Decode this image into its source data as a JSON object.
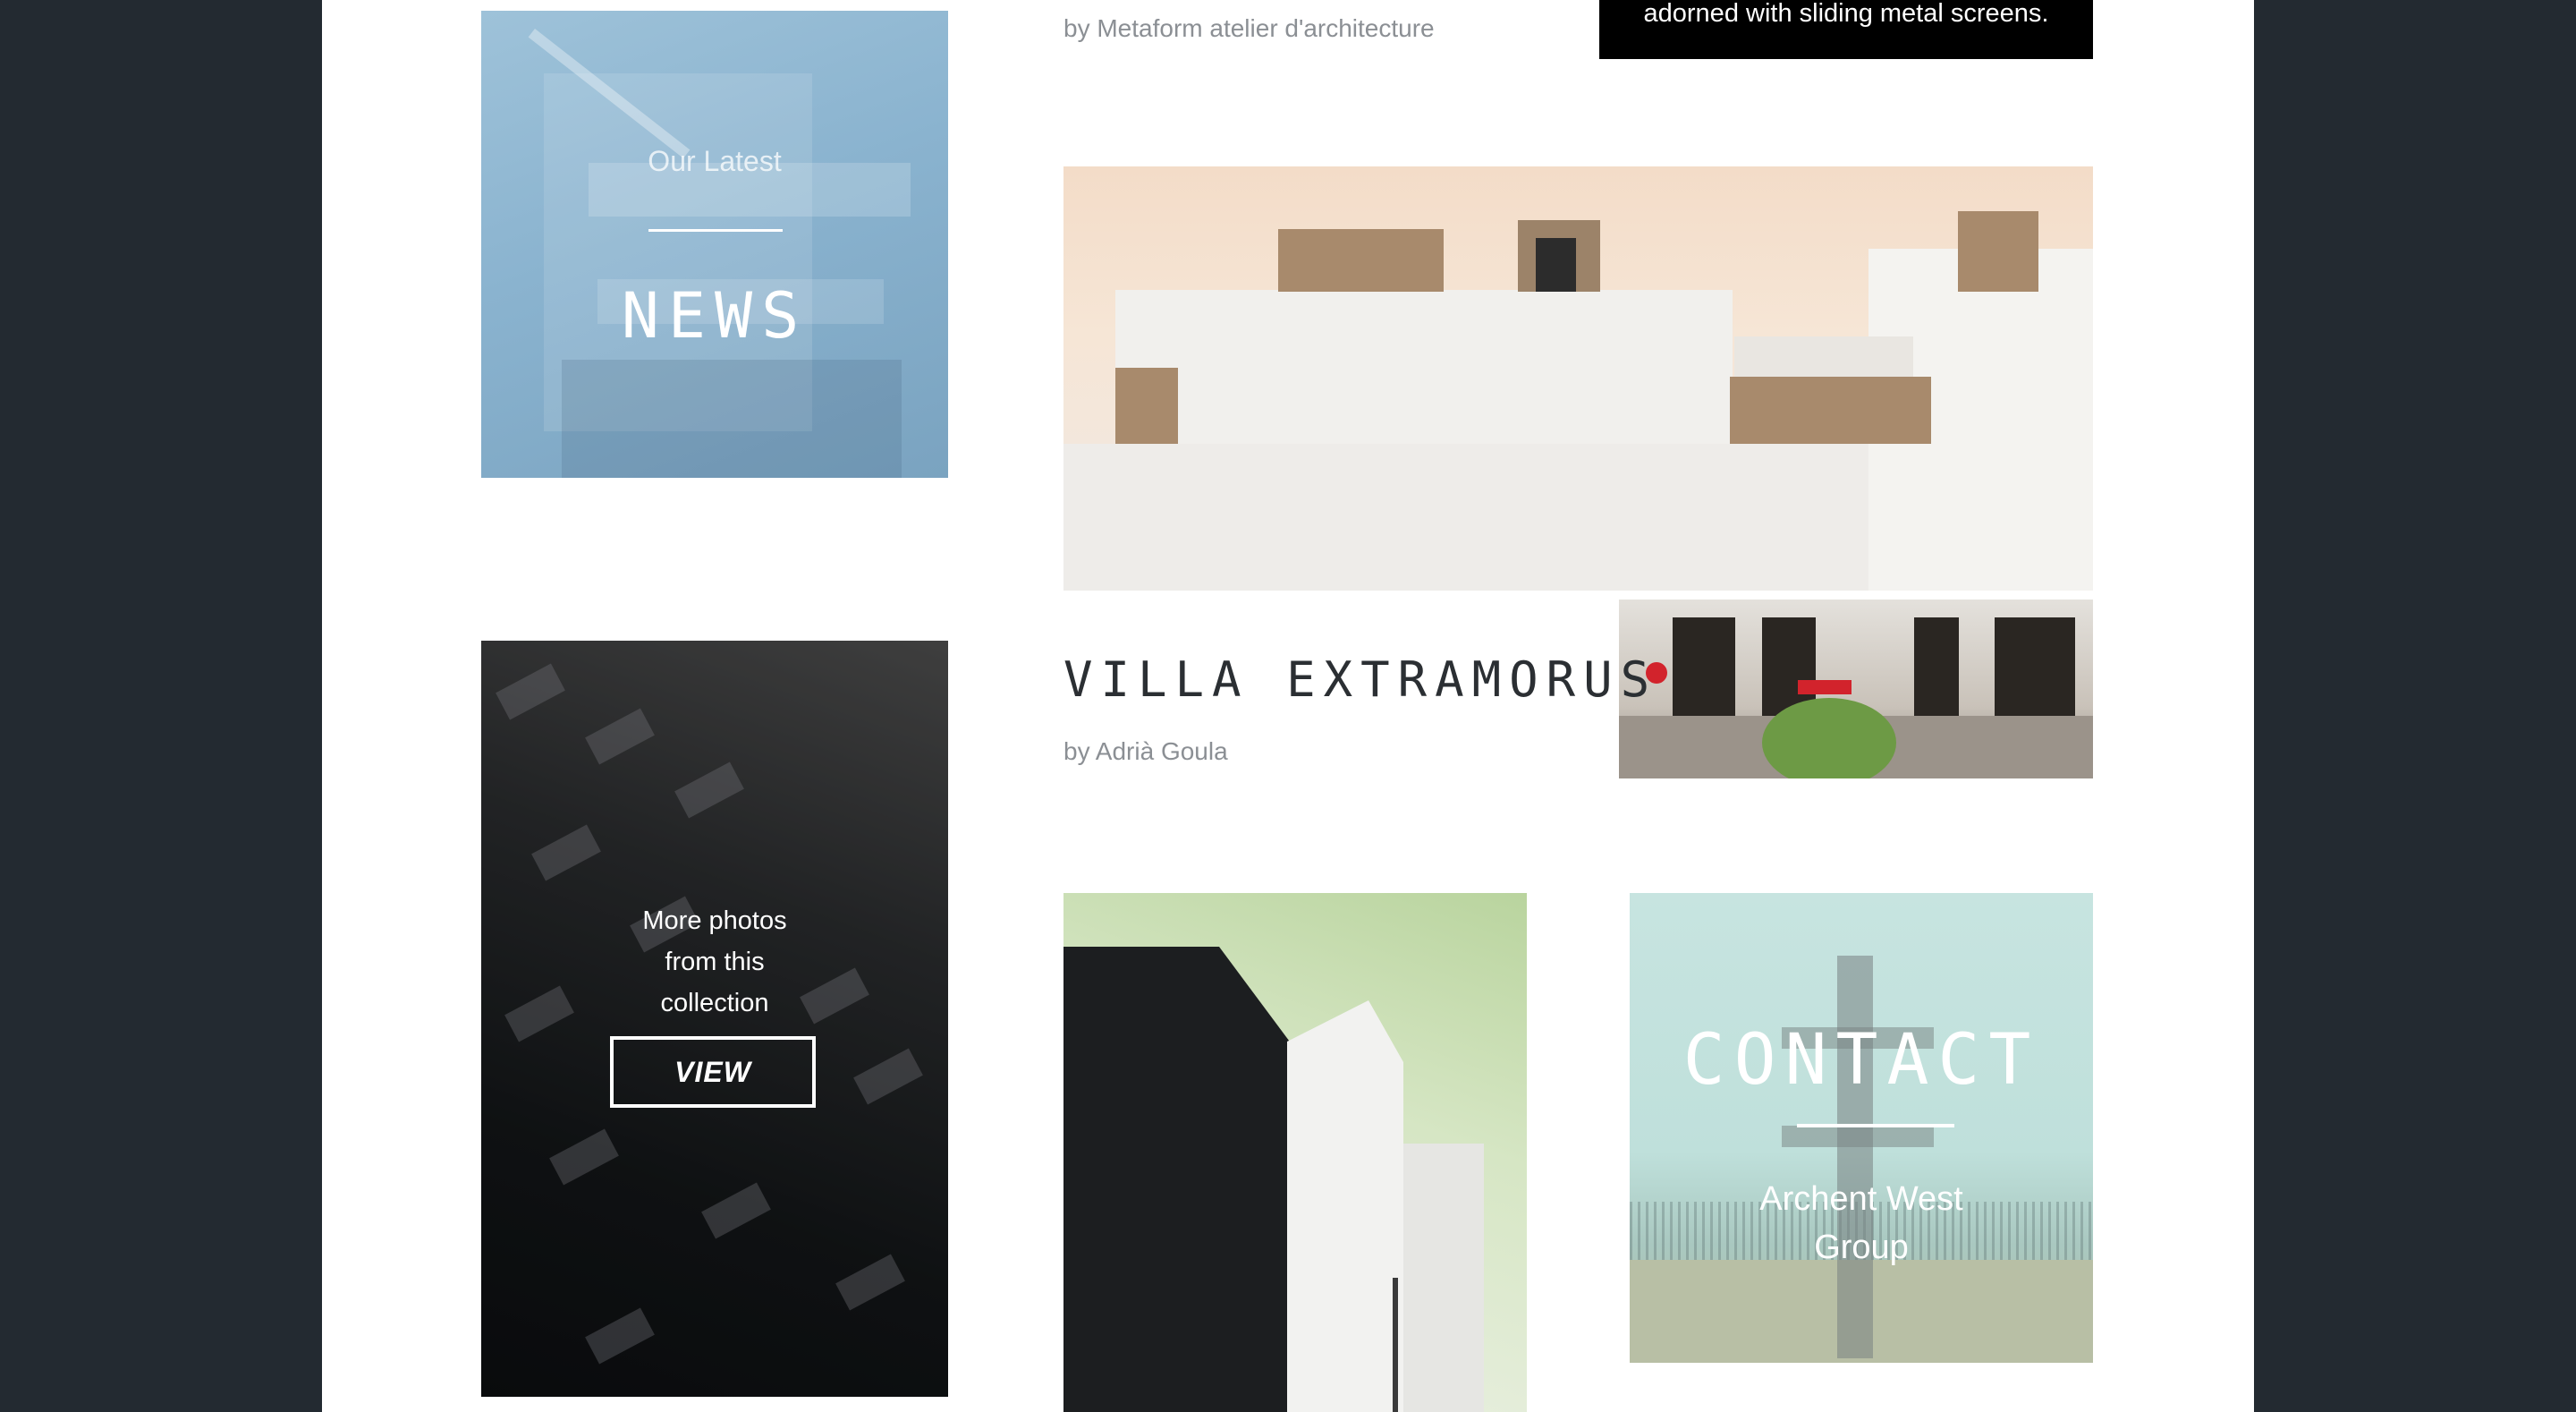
{
  "colors": {
    "background": "#232a31",
    "page": "#ffffff",
    "caption": "#8b8f94",
    "heading": "#2b2f33"
  },
  "news_tile": {
    "subtitle": "Our Latest",
    "title": "NEWS"
  },
  "top_caption": {
    "byline": "by Metaform atelier d'architecture"
  },
  "black_box": {
    "text": "adorned with sliding metal screens."
  },
  "collection_tile": {
    "message": "More photos from this collection",
    "button_label": "VIEW"
  },
  "villa": {
    "title": "VILLA EXTRAMORUS",
    "byline": "by Adrià Goula"
  },
  "contact_tile": {
    "title": "CONTACT",
    "subtitle": "Archent West Group"
  }
}
